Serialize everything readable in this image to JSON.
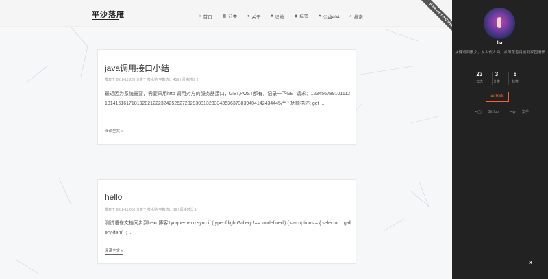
{
  "header": {
    "brand": "平沙落雁",
    "nav": [
      {
        "icon": "home-icon",
        "glyph": "⌂",
        "label": "首页"
      },
      {
        "icon": "th-icon",
        "glyph": "▦",
        "label": "分类"
      },
      {
        "icon": "user-icon",
        "glyph": "●",
        "label": "关于"
      },
      {
        "icon": "archive-icon",
        "glyph": "■",
        "label": "归档"
      },
      {
        "icon": "tags-icon",
        "glyph": "◆",
        "label": "标签"
      },
      {
        "icon": "heartbeat-icon",
        "glyph": "♥",
        "label": "公益404"
      },
      {
        "icon": "search-icon",
        "glyph": "⌕",
        "label": "搜索"
      }
    ],
    "ribbon": "Fork me on GitHub"
  },
  "posts": [
    {
      "title": "java调用接口小结",
      "meta": "发表于 2018-11-20  |  分类于 技术贴  字数统计 459  |  阅读时长 2",
      "body": "最近因为系统需要，需要采用http 调用对方的服务器接口，GET,POST都有，记录一下GET请求：12345678910111213141516171819202122232425262728293031323334353637383940414243444​5/** * 功能描述: get ...",
      "readmore": "阅读全文 »"
    },
    {
      "title": "hello",
      "meta": "发表于 2018-11-05  |  分类于 技术贴  字数统计 16  |  阅读时长 1",
      "body": "测试语雀文档同步到hexo博客1yuque-hexo sync if (typeof lightGallery !== 'undefined') { var options = { selector: '.gallery-item' }; ...",
      "readmore": "阅读全文 »"
    }
  ],
  "sidebar": {
    "author": "lsr",
    "description": "从诗词到散文，从古代人间，从风花雪月谈到家国情怀",
    "stats": [
      {
        "num": "23",
        "label": "日志"
      },
      {
        "num": "3",
        "label": "分类"
      },
      {
        "num": "6",
        "label": "标签"
      }
    ],
    "rss": "RSS",
    "links": [
      "GitHub",
      "知乎"
    ]
  },
  "close": "×"
}
